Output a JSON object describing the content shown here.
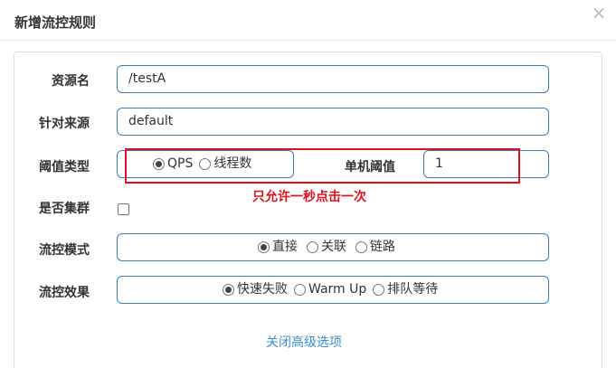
{
  "dialog": {
    "title": "新增流控规则",
    "close_glyph": "×"
  },
  "form": {
    "resource": {
      "label": "资源名",
      "value": "/testA"
    },
    "limit_app": {
      "label": "针对来源",
      "value": "default"
    },
    "threshold_type": {
      "label": "阈值类型",
      "options": [
        "QPS",
        "线程数"
      ],
      "selected": "QPS"
    },
    "threshold": {
      "label": "单机阈值",
      "value": "1"
    },
    "cluster": {
      "label": "是否集群",
      "checked": false
    },
    "control_mode": {
      "label": "流控模式",
      "options": [
        "直接",
        "关联",
        "链路"
      ],
      "selected": "直接"
    },
    "control_effect": {
      "label": "流控效果",
      "options": [
        "快速失败",
        "Warm Up",
        "排队等待"
      ],
      "selected": "快速失败"
    },
    "advanced_link": "关闭高级选项"
  },
  "annotation": {
    "text": "只允许一秒点击一次",
    "color": "#e0101a"
  },
  "colors": {
    "field_border": "#3a7ab8",
    "link": "#3a8fd0"
  }
}
